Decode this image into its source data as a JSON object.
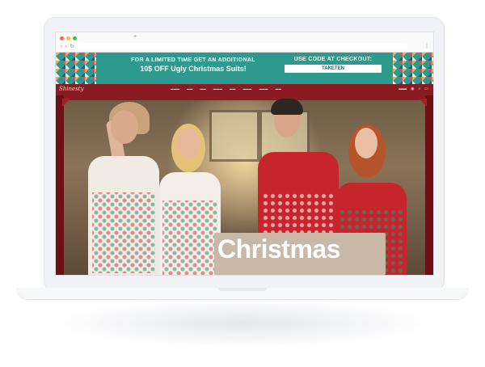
{
  "browser": {
    "tab_add": "+",
    "nav_glyphs": "‹ › ↻"
  },
  "promo": {
    "line1": "FOR A LIMITED TIME GET AN ADDITIONAL",
    "line2": "10$ OFF Ugly Christmas Suits!",
    "code_label": "USE CODE AT CHECKOUT:",
    "code": "TAKETEN"
  },
  "site": {
    "logo": "Shinesty"
  },
  "hero": {
    "sign": "Christmas"
  }
}
